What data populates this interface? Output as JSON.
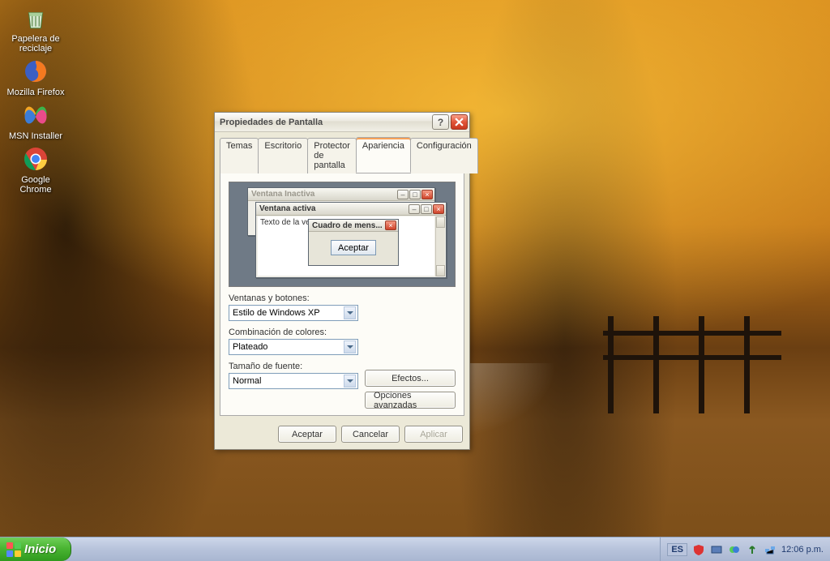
{
  "desktop": {
    "icons": [
      {
        "id": "recycle-bin",
        "label": "Papelera de\nreciclaje"
      },
      {
        "id": "firefox",
        "label": "Mozilla Firefox"
      },
      {
        "id": "msn-installer",
        "label": "MSN Installer"
      },
      {
        "id": "google-chrome",
        "label": "Google\nChrome"
      }
    ]
  },
  "dialog": {
    "title": "Propiedades de Pantalla",
    "tabs": [
      "Temas",
      "Escritorio",
      "Protector de pantalla",
      "Apariencia",
      "Configuración"
    ],
    "active_tab": "Apariencia",
    "preview": {
      "inactive_title": "Ventana Inactiva",
      "active_title": "Ventana activa",
      "content_text": "Texto de la vent",
      "msgbox_title": "Cuadro de mens...",
      "msgbox_button": "Aceptar"
    },
    "controls": {
      "windows_buttons_label": "Ventanas y botones:",
      "windows_buttons_value": "Estilo de Windows XP",
      "color_scheme_label": "Combinación de colores:",
      "color_scheme_value": "Plateado",
      "font_size_label": "Tamaño de fuente:",
      "font_size_value": "Normal",
      "effects_button": "Efectos...",
      "advanced_button": "Opciones avanzadas"
    },
    "buttons": {
      "ok": "Aceptar",
      "cancel": "Cancelar",
      "apply": "Aplicar"
    }
  },
  "taskbar": {
    "start": "Inicio",
    "lang": "ES",
    "clock": "12:06 p.m."
  }
}
